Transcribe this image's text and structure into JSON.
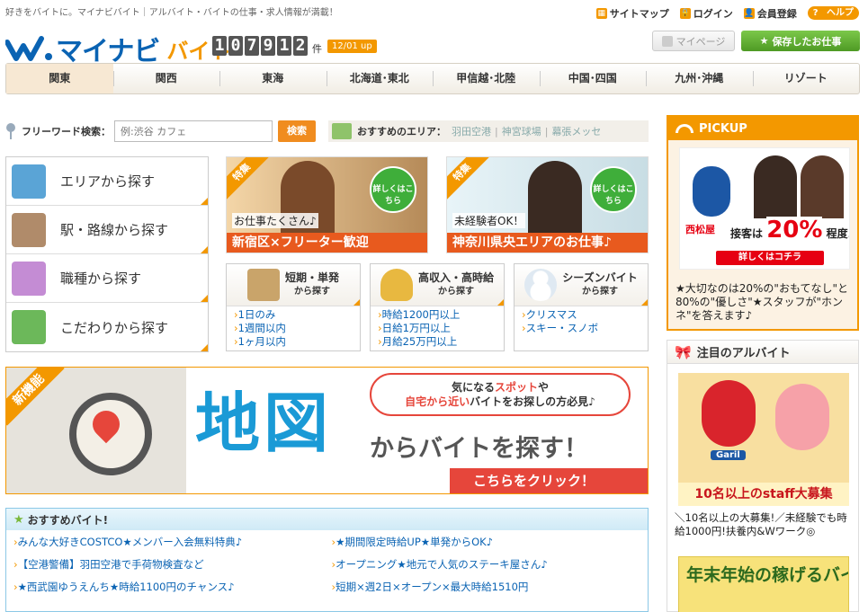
{
  "header": {
    "tagline": "好きをバイトに。マイナビバイト｜アルバイト・バイトの仕事・求人情報が満載！",
    "links": [
      {
        "label": "サイトマップ",
        "icon": "sitemap-icon"
      },
      {
        "label": "ログイン",
        "icon": "lock-icon"
      },
      {
        "label": "会員登録",
        "icon": "user-icon"
      }
    ],
    "help": "ヘルプ",
    "logo_main": "マイナビ",
    "logo_sub": "バイト",
    "count_digits": [
      "1",
      "0",
      "7",
      "9",
      "1",
      "2"
    ],
    "count_unit": "件",
    "updated": "12/01 up",
    "mypage": "マイページ",
    "saved_jobs": "保存したお仕事"
  },
  "regions": [
    "関東",
    "関西",
    "東海",
    "北海道･東北",
    "甲信越･北陸",
    "中国･四国",
    "九州･沖縄",
    "リゾート"
  ],
  "search": {
    "label": "フリーワード検索：",
    "placeholder": "例:渋谷 カフェ",
    "button": "検索",
    "area_label": "おすすめのエリア：",
    "areas": [
      "羽田空港",
      "神宮球場",
      "幕張メッセ"
    ]
  },
  "categories": [
    {
      "label": "エリアから探す",
      "icon": "map-icon",
      "color": "#5aa4d6"
    },
    {
      "label": "駅・路線から探す",
      "icon": "train-icon",
      "color": "#b08b6a"
    },
    {
      "label": "職種から探す",
      "icon": "people-icon",
      "color": "#c48cd4"
    },
    {
      "label": "こだわりから探す",
      "icon": "pen-icon",
      "color": "#6cb85a"
    }
  ],
  "features": [
    {
      "tag": "特集",
      "bubble": "詳しくはこちら",
      "sub": "お仕事たくさん♪",
      "main": "新宿区×フリーター歓迎"
    },
    {
      "tag": "特集",
      "bubble": "詳しくはこちら",
      "sub": "未経験者OK！",
      "main": "神奈川県央エリアのお仕事♪"
    }
  ],
  "miniboxes": [
    {
      "title": "短期・単発",
      "sub": "から探す",
      "items": [
        "1日のみ",
        "1週間以内",
        "1ヶ月以内"
      ],
      "icon": "calendar-icon",
      "color": "#c9a46a"
    },
    {
      "title": "高収入・高時給",
      "sub": "から探す",
      "items": [
        "時給1200円以上",
        "日給1万円以上",
        "月給25万円以上"
      ],
      "icon": "money-bag-icon",
      "color": "#e8b840"
    },
    {
      "title": "シーズンバイト",
      "sub": "から探す",
      "items": [
        "クリスマス",
        "スキー・スノボ"
      ],
      "icon": "snowman-icon",
      "color": "#e8eef4"
    }
  ],
  "map_banner": {
    "new": "新機能",
    "bubble_a": "気になる",
    "bubble_spot": "スポット",
    "bubble_b": "や",
    "bubble_near": "自宅から近い",
    "bubble_c": "バイトをお探しの方必見♪",
    "big": "地図",
    "sub": "からバイトを探す！",
    "click": "こちらをクリック！"
  },
  "recommend": {
    "title": "おすすめバイト!",
    "items": [
      "みんな大好きCOSTCO★メンバー入会無料特典♪",
      "★期間限定時給UP★単発からOK♪",
      "【空港警備】羽田空港で手荷物検査など",
      "オープニング★地元で人気のステーキ屋さん♪",
      "★西武園ゆうえんち★時給1100円のチャンス♪",
      "短期×週2日×オープン×最大時給1510円"
    ]
  },
  "pickup": {
    "title": "PICKUP",
    "store": "西松屋",
    "pct_a": "接客は",
    "pct": "20%",
    "pct_b": "程度♪",
    "button": "詳しくはコチラ",
    "text": "★大切なのは20%の\"おもてなし\"と80%の\"優しさ\"★スタッフが\"ホンネ\"を答えます♪"
  },
  "attention": {
    "title": "注目のアルバイト",
    "mascot": "Garil",
    "caption": "10名以上のstaff大募集",
    "text": "＼10名以上の大募集!／未経験でも時給1000円!扶養内&Wワーク◎",
    "banner2": "年末年始の稼げるバイト!!"
  }
}
